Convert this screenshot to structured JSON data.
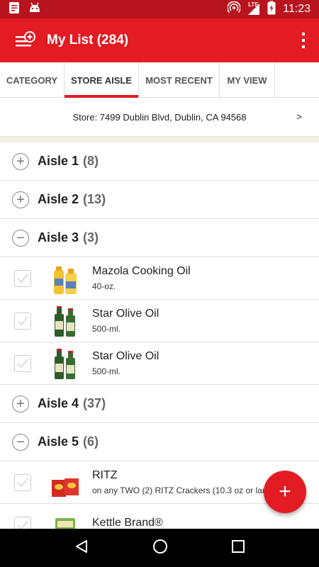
{
  "status_bar": {
    "time": "11:23",
    "network": "LTE",
    "icons": [
      "notes-icon",
      "android-icon",
      "hotspot-icon",
      "signal-icon",
      "battery-charging-icon"
    ]
  },
  "app_bar": {
    "title": "My List (284)",
    "list_icon": "add-list-icon",
    "menu_icon": "more-vert-icon"
  },
  "tabs": [
    {
      "label": "CATEGORY",
      "active": false
    },
    {
      "label": "STORE AISLE",
      "active": true
    },
    {
      "label": "MOST RECENT",
      "active": false
    },
    {
      "label": "MY VIEW",
      "active": false
    }
  ],
  "store": {
    "label": "Store: 7499 Dublin Blvd, Dublin, CA 94568",
    "chevron": ">"
  },
  "aisles": [
    {
      "name": "Aisle 1",
      "count": "(8)",
      "expanded": false,
      "toggle": "+",
      "items": []
    },
    {
      "name": "Aisle 2",
      "count": "(13)",
      "expanded": false,
      "toggle": "+",
      "items": []
    },
    {
      "name": "Aisle 3",
      "count": "(3)",
      "expanded": true,
      "toggle": "−",
      "items": [
        {
          "name": "Mazola Cooking Oil",
          "desc": "40-oz.",
          "thumb": "yellow-oil-bottles"
        },
        {
          "name": "Star Olive Oil",
          "desc": "500-ml.",
          "thumb": "green-olive-oil-bottles"
        },
        {
          "name": "Star Olive Oil",
          "desc": "500-ml.",
          "thumb": "green-olive-oil-bottles"
        }
      ]
    },
    {
      "name": "Aisle 4",
      "count": "(37)",
      "expanded": false,
      "toggle": "+",
      "items": []
    },
    {
      "name": "Aisle 5",
      "count": "(6)",
      "expanded": true,
      "toggle": "−",
      "items": [
        {
          "name": "RITZ",
          "desc": "on any TWO (2) RITZ Crackers (10.3 oz or lar",
          "thumb": "ritz-boxes"
        },
        {
          "name": "Kettle Brand®",
          "desc": "",
          "thumb": "kettle-chips-bag"
        }
      ]
    }
  ],
  "fab": {
    "label": "+"
  },
  "nav_bar": {
    "icons": [
      "back-icon",
      "home-icon",
      "recents-icon"
    ]
  },
  "colors": {
    "primary": "#e31b23",
    "status_bar": "#b8141d",
    "accent_underline": "#e31b23"
  }
}
